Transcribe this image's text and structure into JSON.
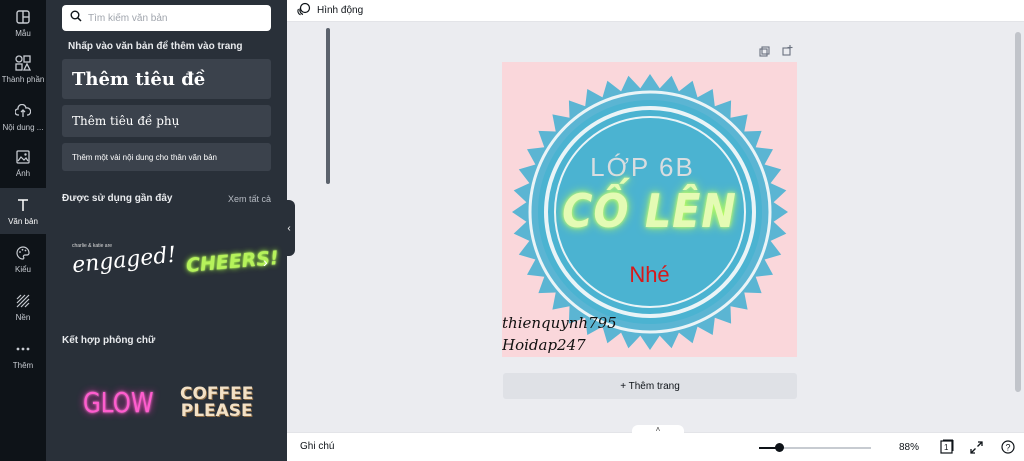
{
  "rail": {
    "items": [
      {
        "label": "Mẫu",
        "icon": "template-icon"
      },
      {
        "label": "Thành phần",
        "icon": "elements-icon"
      },
      {
        "label": "Nội dung ...",
        "icon": "upload-icon"
      },
      {
        "label": "Ảnh",
        "icon": "image-icon"
      },
      {
        "label": "Văn bản",
        "icon": "text-icon",
        "active": true
      },
      {
        "label": "Kiểu",
        "icon": "palette-icon"
      },
      {
        "label": "Nền",
        "icon": "background-icon"
      },
      {
        "label": "Thêm",
        "icon": "more-icon"
      }
    ]
  },
  "panel": {
    "search_placeholder": "Tìm kiếm văn bản",
    "hint": "Nhấp vào văn bản để thêm vào trang",
    "add_heading": "Thêm tiêu đề",
    "add_subheading": "Thêm tiêu đề phụ",
    "add_body": "Thêm một vài nội dung cho thân văn bản",
    "recent_title": "Được sử dụng gần đây",
    "see_all": "Xem tất cả",
    "recent_small": "charlie & katie are",
    "recent_1": "engaged!",
    "recent_2": "CHEERS!",
    "combo_title": "Kết hợp phông chữ",
    "combo_1": "GLOW",
    "combo_2_line1": "COFFEE",
    "combo_2_line2": "PLEASE"
  },
  "topbar": {
    "animate_label": "Hình động"
  },
  "design": {
    "line1": "LỚP 6B",
    "line2": "CỐ LÊN",
    "line3": "Nhé",
    "signature1": "thienquynh795",
    "signature2": "Hoidap247",
    "colors": {
      "background": "#fad7db",
      "seal_outer": "#5bb5d3",
      "seal_inner": "#4bb3d1",
      "ring": "#eaf4f7"
    }
  },
  "canvas": {
    "add_page": "+ Thêm trang"
  },
  "bottombar": {
    "notes": "Ghi chú",
    "zoom": "88%",
    "zoom_fraction": 0.18,
    "page_number": "1"
  }
}
